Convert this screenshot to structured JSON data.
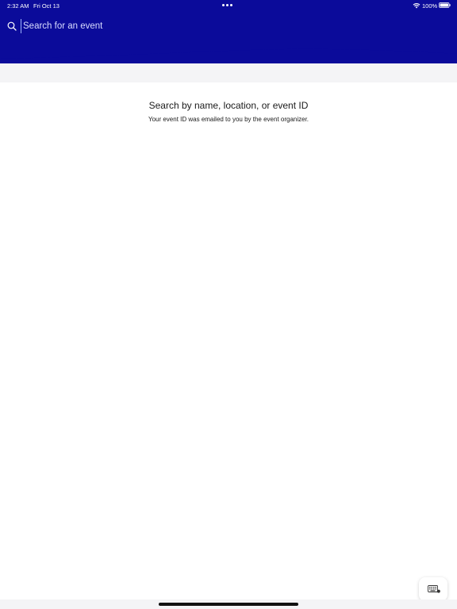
{
  "status_bar": {
    "time": "2:32 AM",
    "date": "Fri Oct 13",
    "battery": "100%",
    "icons": [
      "wifi-icon",
      "battery-icon",
      "multitasking-dots-icon"
    ]
  },
  "search": {
    "placeholder": "Search for an event",
    "value": "",
    "icon": "search-icon"
  },
  "empty_state": {
    "title": "Search by name, location, or event ID",
    "subtitle": "Your event ID was emailed to you by the event organizer."
  },
  "keyboard_button": {
    "icon": "keyboard-icon"
  },
  "colors": {
    "header": "#0b0b9a",
    "band": "#f4f4f6",
    "text": "#1a1a1a"
  }
}
